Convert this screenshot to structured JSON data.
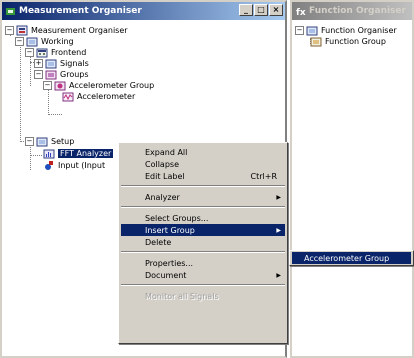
{
  "window_main": {
    "title": "Measurement Organiser",
    "controls": [
      "_",
      "□",
      "×"
    ]
  },
  "window_function": {
    "title": "Function Organiser"
  },
  "tree_main": {
    "root": "Measurement Organiser",
    "working": "Working",
    "frontend": "Frontend",
    "signals": "Signals",
    "groups": "Groups",
    "accel_group": "Accelerometer Group",
    "accelerometer": "Accelerometer",
    "setup": "Setup",
    "fft": "FFT Analyzer",
    "input": "Input (Input"
  },
  "tree_function": {
    "root": "Function Organiser",
    "child": "Function Group"
  },
  "context_menu": {
    "expand_all": "Expand All",
    "collapse": "Collapse",
    "edit_label": "Edit Label",
    "edit_label_shortcut": "Ctrl+R",
    "analyzer": "Analyzer",
    "select_groups": "Select Groups...",
    "insert_group": "Insert Group",
    "delete": "Delete",
    "properties": "Properties...",
    "document": "Document",
    "monitor_all": "Monitor all Signals"
  },
  "submenu": {
    "item": "Accelerometer Group"
  },
  "colors": {
    "selection": "#0a246a",
    "menu_bg": "#d4d0c8"
  }
}
